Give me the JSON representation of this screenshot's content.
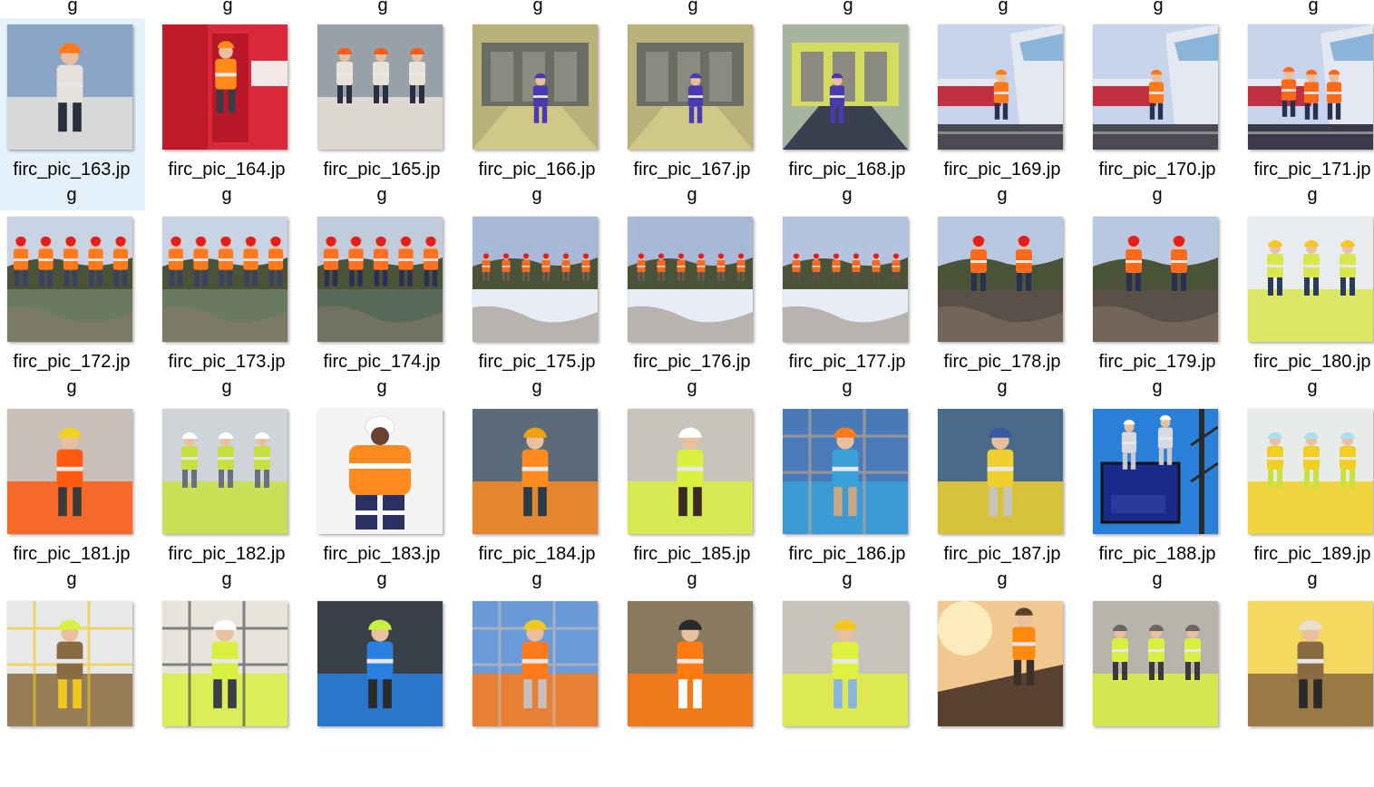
{
  "folder_view": {
    "partial_top_row": [
      "g",
      "g",
      "g",
      "g",
      "g",
      "g",
      "g",
      "g",
      "g"
    ],
    "selected_index": 0,
    "items": [
      {
        "name_line1": "firc_pic_163.jp",
        "name_line2": "g",
        "scene": "portrait-vest",
        "palette": [
          "#8aa6c4",
          "#e4e0dc",
          "#ff7a1a",
          "#2a2f3c"
        ]
      },
      {
        "name_line1": "firc_pic_164.jp",
        "name_line2": "g",
        "scene": "train-door",
        "palette": [
          "#d8283a",
          "#c01a2a",
          "#ff8a1a",
          "#3a3a48"
        ]
      },
      {
        "name_line1": "firc_pic_165.jp",
        "name_line2": "g",
        "scene": "team-close",
        "palette": [
          "#9aa0a8",
          "#e8e2d8",
          "#ff5a1a",
          "#2a3040"
        ]
      },
      {
        "name_line1": "firc_pic_166.jp",
        "name_line2": "g",
        "scene": "depot",
        "palette": [
          "#b8b27a",
          "#6a6e64",
          "#4a3ab0",
          "#d0c888"
        ]
      },
      {
        "name_line1": "firc_pic_167.jp",
        "name_line2": "g",
        "scene": "depot",
        "palette": [
          "#b8b27a",
          "#6a6e64",
          "#4a3ab0",
          "#d0c888"
        ]
      },
      {
        "name_line1": "firc_pic_168.jp",
        "name_line2": "g",
        "scene": "platform",
        "palette": [
          "#a8b4a0",
          "#d4dc60",
          "#4a3ab0",
          "#3a4050"
        ]
      },
      {
        "name_line1": "firc_pic_169.jp",
        "name_line2": "g",
        "scene": "locomotive",
        "palette": [
          "#e4e8f0",
          "#8ab4d8",
          "#ff7a1a",
          "#4a4a52"
        ]
      },
      {
        "name_line1": "firc_pic_170.jp",
        "name_line2": "g",
        "scene": "locomotive",
        "palette": [
          "#e4e8f0",
          "#8ab4d8",
          "#ff7a1a",
          "#4a4a52"
        ]
      },
      {
        "name_line1": "firc_pic_171.jp",
        "name_line2": "g",
        "scene": "locomotive-team",
        "palette": [
          "#e4e8f0",
          "#8ab4d8",
          "#ff6a1a",
          "#3a3a48"
        ]
      },
      {
        "name_line1": "firc_pic_172.jp",
        "name_line2": "g",
        "scene": "snow-team",
        "palette": [
          "#c8d4e4",
          "#6a7a60",
          "#ff7a1a",
          "#3a4060"
        ]
      },
      {
        "name_line1": "firc_pic_173.jp",
        "name_line2": "g",
        "scene": "snow-team",
        "palette": [
          "#c8d4e4",
          "#6a7a60",
          "#ff7a1a",
          "#3a4060"
        ]
      },
      {
        "name_line1": "firc_pic_174.jp",
        "name_line2": "g",
        "scene": "snow-team",
        "palette": [
          "#c0ccdc",
          "#5a6a58",
          "#ff7020",
          "#2a3050"
        ]
      },
      {
        "name_line1": "firc_pic_175.jp",
        "name_line2": "g",
        "scene": "snow-wide",
        "palette": [
          "#a8b8d8",
          "#e8ecf4",
          "#ff6a1a",
          "#6a5a50"
        ]
      },
      {
        "name_line1": "firc_pic_176.jp",
        "name_line2": "g",
        "scene": "snow-wide",
        "palette": [
          "#a8b8d8",
          "#e8ecf4",
          "#ff6a1a",
          "#6a5a50"
        ]
      },
      {
        "name_line1": "firc_pic_177.jp",
        "name_line2": "g",
        "scene": "snow-wave",
        "palette": [
          "#b4c4e0",
          "#e8ecf4",
          "#ff6a1a",
          "#5a5048"
        ]
      },
      {
        "name_line1": "firc_pic_178.jp",
        "name_line2": "g",
        "scene": "snow-pair",
        "palette": [
          "#b8c8e0",
          "#5a5048",
          "#ff6a1a",
          "#2a3050"
        ]
      },
      {
        "name_line1": "firc_pic_179.jp",
        "name_line2": "g",
        "scene": "snow-pair",
        "palette": [
          "#b8c8e0",
          "#5a5048",
          "#ff6a1a",
          "#2a3050"
        ]
      },
      {
        "name_line1": "firc_pic_180.jp",
        "name_line2": "g",
        "scene": "engineers",
        "palette": [
          "#e8ecef",
          "#d8e84a",
          "#f8c820",
          "#2a3a5a"
        ]
      },
      {
        "name_line1": "firc_pic_181.jp",
        "name_line2": "g",
        "scene": "grinder",
        "palette": [
          "#c8c0b8",
          "#ff5a10",
          "#f0d020",
          "#3a3a3a"
        ]
      },
      {
        "name_line1": "firc_pic_182.jp",
        "name_line2": "g",
        "scene": "hallway",
        "palette": [
          "#d0d4d8",
          "#c8e040",
          "#ffffff",
          "#6a7080"
        ]
      },
      {
        "name_line1": "firc_pic_183.jp",
        "name_line2": "g",
        "scene": "coverall",
        "palette": [
          "#f4f4f4",
          "#ff8a20",
          "#2a3060",
          "#ffffff"
        ]
      },
      {
        "name_line1": "firc_pic_184.jp",
        "name_line2": "g",
        "scene": "back-view",
        "palette": [
          "#5a6a78",
          "#ff8a20",
          "#f0a010",
          "#2a3a48"
        ]
      },
      {
        "name_line1": "firc_pic_185.jp",
        "name_line2": "g",
        "scene": "radio",
        "palette": [
          "#c8c4bc",
          "#d8f040",
          "#ffffff",
          "#3a2a20"
        ]
      },
      {
        "name_line1": "firc_pic_186.jp",
        "name_line2": "g",
        "scene": "construction",
        "palette": [
          "#4a7ab8",
          "#3aa0d8",
          "#ff7a1a",
          "#c8a888"
        ]
      },
      {
        "name_line1": "firc_pic_187.jp",
        "name_line2": "g",
        "scene": "mask-worker",
        "palette": [
          "#4a6a88",
          "#f0d030",
          "#3a5aa0",
          "#c8c4b8"
        ]
      },
      {
        "name_line1": "firc_pic_188.jp",
        "name_line2": "g",
        "scene": "lift",
        "palette": [
          "#2a80d8",
          "#1a2a8a",
          "#ffffff",
          "#2a2a2a"
        ]
      },
      {
        "name_line1": "firc_pic_189.jp",
        "name_line2": "g",
        "scene": "mask-group",
        "palette": [
          "#e8ece8",
          "#f0d020",
          "#a8e0f0",
          "#c8e040"
        ]
      },
      {
        "name_line1": "",
        "name_line2": "",
        "scene": "scaffold",
        "palette": [
          "#e8e8e8",
          "#8a6a40",
          "#d8f040",
          "#f0c820"
        ]
      },
      {
        "name_line1": "",
        "name_line2": "",
        "scene": "ladder",
        "palette": [
          "#e8e4dc",
          "#d8f040",
          "#ffffff",
          "#3a4048"
        ]
      },
      {
        "name_line1": "",
        "name_line2": "",
        "scene": "blue-helmet",
        "palette": [
          "#3a4048",
          "#2a80e0",
          "#c8f040",
          "#2a2a2a"
        ]
      },
      {
        "name_line1": "",
        "name_line2": "",
        "scene": "roof",
        "palette": [
          "#6a9ad8",
          "#ff7a1a",
          "#f0c820",
          "#c8c0b8"
        ]
      },
      {
        "name_line1": "",
        "name_line2": "",
        "scene": "harness",
        "palette": [
          "#8a7a60",
          "#ff7a10",
          "#2a2a2a",
          "#ffffff"
        ]
      },
      {
        "name_line1": "",
        "name_line2": "",
        "scene": "plans",
        "palette": [
          "#c8c4bc",
          "#e0f040",
          "#f0c820",
          "#8ab4e0"
        ]
      },
      {
        "name_line1": "",
        "name_line2": "",
        "scene": "sunset",
        "palette": [
          "#f0c890",
          "#ff8a10",
          "#5a4030",
          "#3a3028"
        ]
      },
      {
        "name_line1": "",
        "name_line2": "",
        "scene": "site-top",
        "palette": [
          "#b8b4ac",
          "#d8f040",
          "#6a6864",
          "#3a3a3a"
        ]
      },
      {
        "name_line1": "",
        "name_line2": "",
        "scene": "gloves",
        "palette": [
          "#f4d860",
          "#8a6a40",
          "#e8e0d0",
          "#2a2a2a"
        ]
      }
    ]
  }
}
